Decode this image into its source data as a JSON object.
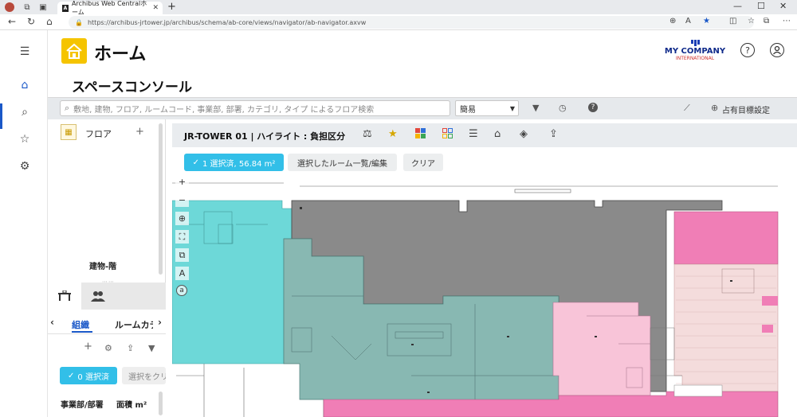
{
  "browser": {
    "tab_title": "Archibus Web Centralホーム",
    "tab_favicon_letter": "A",
    "url": "https://archibus-jrtower.jp/archibus/schema/ab-core/views/navigator/ab-navigator.axvw"
  },
  "header": {
    "title": "ホーム",
    "logo_main": "MY COMPANY",
    "logo_sub": "INTERNATIONAL",
    "help_label": "?"
  },
  "page": {
    "title": "スペースコンソール"
  },
  "toolbar": {
    "search_placeholder": "敷地, 建物, フロア, ルームコード, 事業部, 部署, カテゴリ, タイプ によるフロア検索",
    "mode_value": "簡易",
    "occupancy_label": "占有目標設定"
  },
  "floor_panel": {
    "label": "フロア",
    "add_label": "+",
    "building_level": "建物-階"
  },
  "org_panel": {
    "tab_org": "組織",
    "tab_room": "ルームカテゴリ",
    "selected_count": "0 選択済",
    "select_button": "選択をクリア",
    "col_department": "事業部/部署",
    "col_area": "面積 m²"
  },
  "drawing": {
    "title": "JR-TOWER 01 | ハイライト : 負担区分",
    "selected_badge": "1 選択済, 56.84 m²",
    "selected_list": "選択したルーム一覧/編集",
    "clear": "クリア",
    "zoom_in": "+",
    "zoom_out": "−",
    "text_tool_A": "A",
    "text_tool_a": "a"
  },
  "colors": {
    "accent_blue": "#1a58c8",
    "badge_cyan": "#32bfe8",
    "plan_cyan": "#6dd8d8",
    "plan_gray": "#8a8a8a",
    "plan_teal": "#88b8b2",
    "plan_pink": "#f07eb6",
    "plan_light_pink": "#f8c4d8",
    "home_yellow": "#f5c400"
  }
}
